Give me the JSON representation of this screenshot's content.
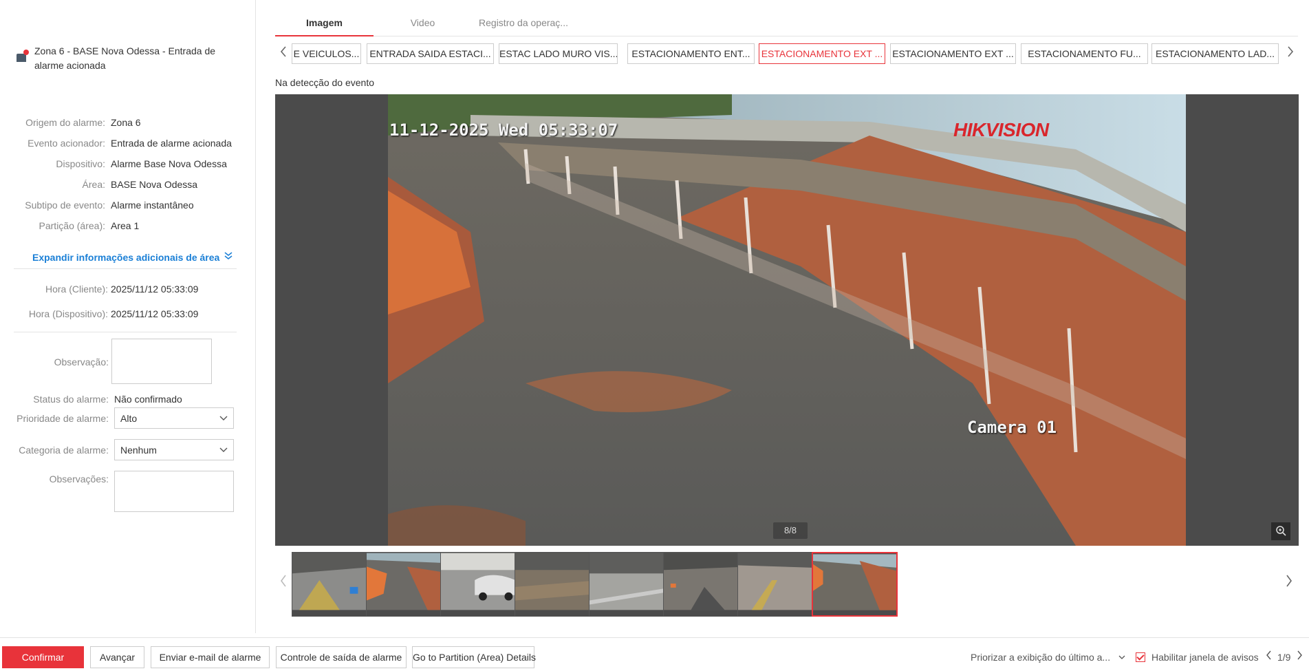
{
  "alarm": {
    "title": "Zona 6 - BASE Nova Odessa - Entrada de alarme acionada",
    "fields": [
      {
        "label": "Origem do alarme:",
        "value": "Zona 6"
      },
      {
        "label": "Evento acionador:",
        "value": "Entrada de alarme acionada"
      },
      {
        "label": "Dispositivo:",
        "value": "Alarme Base Nova Odessa"
      },
      {
        "label": "Área:",
        "value": "BASE Nova Odessa"
      },
      {
        "label": "Subtipo de evento:",
        "value": "Alarme instantâneo"
      },
      {
        "label": "Partição (área):",
        "value": "Area 1"
      }
    ],
    "expand_label": "Expandir informações adicionais de área",
    "times": [
      {
        "label": "Hora (Cliente):",
        "value": "2025/11/12 05:33:09"
      },
      {
        "label": "Hora (Dispositivo):",
        "value": "2025/11/12 05:33:09"
      }
    ],
    "observacao_label": "Observação:",
    "status_label": "Status do alarme:",
    "status_value": "Não confirmado",
    "priority_label": "Prioridade de alarme:",
    "priority_value": "Alto",
    "category_label": "Categoria de alarme:",
    "category_value": "Nenhum",
    "observacoes_label": "Observações:"
  },
  "tabs": [
    "Imagem",
    "Video",
    "Registro da operaç..."
  ],
  "cameras": [
    "E VEICULOS...",
    "ENTRADA SAIDA ESTACI...",
    "ESTAC LADO MURO VIS...",
    "ESTACIONAMENTO ENT...",
    "ESTACIONAMENTO EXT ...",
    "ESTACIONAMENTO EXT ...",
    "ESTACIONAMENTO FU...",
    "ESTACIONAMENTO LAD..."
  ],
  "event_label": "Na detecção do evento",
  "viewer": {
    "osd_date": "11-12-2025 Wed 05:33:07",
    "osd_brand": "HIKVISION",
    "osd_camera": "Camera 01",
    "counter": "8/8"
  },
  "footer": {
    "confirm": "Confirmar",
    "next": "Avançar",
    "email": "Enviar e-mail de alarme",
    "output": "Controle de saída de alarme",
    "partition": "Go to Partition (Area) Details",
    "priority_display": "Priorizar a exibição do último a...",
    "enable_popup": "Habilitar janela de avisos",
    "page": "1/9"
  },
  "colors": {
    "accent": "#e8333a",
    "link": "#1a7fd6"
  }
}
